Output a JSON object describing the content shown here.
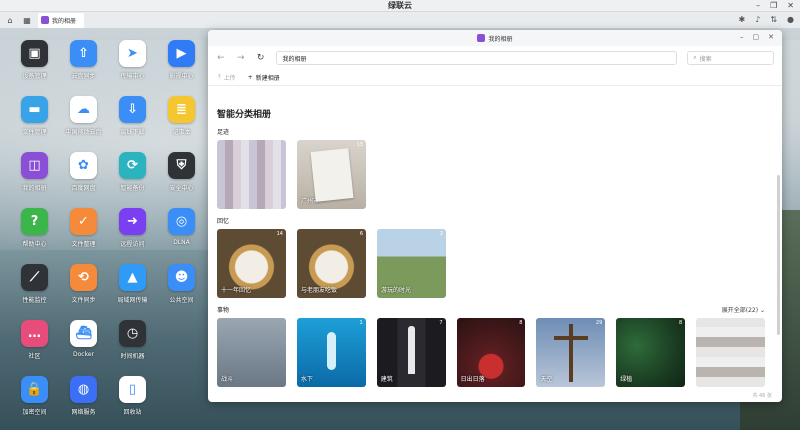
{
  "system": {
    "title": "绿联云"
  },
  "taskbar": {
    "app_label": "我的相册"
  },
  "desktop": {
    "icons": [
      {
        "label": "设备管理",
        "icon": "device-icon",
        "color": "#2f3338"
      },
      {
        "label": "云盘同步",
        "icon": "cloud-upload-icon",
        "color": "#3a8ef6"
      },
      {
        "label": "传输中心",
        "icon": "paper-plane-icon",
        "color": "#ffffff"
      },
      {
        "label": "影视中心",
        "icon": "play-icon",
        "color": "#2f7cf6"
      },
      {
        "label": "文件管理",
        "icon": "folder-icon",
        "color": "#39a3e8"
      },
      {
        "label": "中国移动云盘",
        "icon": "cloud-icon",
        "color": "#ffffff"
      },
      {
        "label": "离线下载",
        "icon": "download-icon",
        "color": "#3a8ef6"
      },
      {
        "label": "记事本",
        "icon": "notepad-icon",
        "color": "#f6c630"
      },
      {
        "label": "我的相册",
        "icon": "photo-icon",
        "color": "#8b4fd6"
      },
      {
        "label": "百度网盘",
        "icon": "baidu-icon",
        "color": "#ffffff"
      },
      {
        "label": "智能备份",
        "icon": "backup-icon",
        "color": "#2bb3c0"
      },
      {
        "label": "安全中心",
        "icon": "shield-icon",
        "color": "#2f3338"
      },
      {
        "label": "帮助中心",
        "icon": "help-icon",
        "color": "#3cb54a"
      },
      {
        "label": "文件整理",
        "icon": "organize-icon",
        "color": "#f58a3a"
      },
      {
        "label": "远程访问",
        "icon": "remote-icon",
        "color": "#7a3ff0"
      },
      {
        "label": "DLNA",
        "icon": "dlna-icon",
        "color": "#3a8ef6"
      },
      {
        "label": "性能监控",
        "icon": "monitor-icon",
        "color": "#2f3338"
      },
      {
        "label": "文件同步",
        "icon": "sync-icon",
        "color": "#f58a3a"
      },
      {
        "label": "局域网传输",
        "icon": "send-icon",
        "color": "#2f9bf6"
      },
      {
        "label": "公共空间",
        "icon": "users-icon",
        "color": "#3a8ef6"
      },
      {
        "label": "社区",
        "icon": "chat-icon",
        "color": "#e84c7a"
      },
      {
        "label": "Docker",
        "icon": "docker-icon",
        "color": "#ffffff"
      },
      {
        "label": "时间机器",
        "icon": "clock-icon",
        "color": "#2f3338"
      },
      {
        "label": "",
        "icon": "",
        "color": ""
      },
      {
        "label": "加密空间",
        "icon": "lock-icon",
        "color": "#3a8ef6"
      },
      {
        "label": "网络服务",
        "icon": "globe-icon",
        "color": "#3a6ff6"
      },
      {
        "label": "回收站",
        "icon": "trash-icon",
        "color": "#ffffff"
      }
    ]
  },
  "window": {
    "title": "我的相册",
    "address": "我的相册",
    "search_placeholder": "搜索",
    "toolbar": {
      "upload": "上传",
      "new_album": "新建相册"
    },
    "heading": "智能分类相册",
    "sections": [
      {
        "title": "足迹",
        "expand": "",
        "albums": [
          {
            "name": "",
            "count": "",
            "style": "c-pixel"
          },
          {
            "name": "广州市",
            "count": "13",
            "style": "c-paper"
          }
        ]
      },
      {
        "title": "回忆",
        "expand": "",
        "albums": [
          {
            "name": "十一年回忆",
            "count": "14",
            "style": "c-meter"
          },
          {
            "name": "与老朋友吃饭",
            "count": "6",
            "style": "c-meter"
          },
          {
            "name": "游玩的时光",
            "count": "2",
            "style": "c-field"
          }
        ]
      },
      {
        "title": "事物",
        "expand": "展开全部(22)",
        "albums": [
          {
            "name": "战斗",
            "count": "",
            "style": "c-jet"
          },
          {
            "name": "水下",
            "count": "1",
            "style": "c-whale"
          },
          {
            "name": "建筑",
            "count": "7",
            "style": "c-rocket"
          },
          {
            "name": "日出日落",
            "count": "8",
            "style": "c-sunset"
          },
          {
            "name": "天空",
            "count": "29",
            "style": "c-cross"
          },
          {
            "name": "绿植",
            "count": "8",
            "style": "c-forest"
          },
          {
            "name": "",
            "count": "",
            "style": "c-mosaic"
          }
        ]
      }
    ],
    "footer": "共 46 张"
  }
}
